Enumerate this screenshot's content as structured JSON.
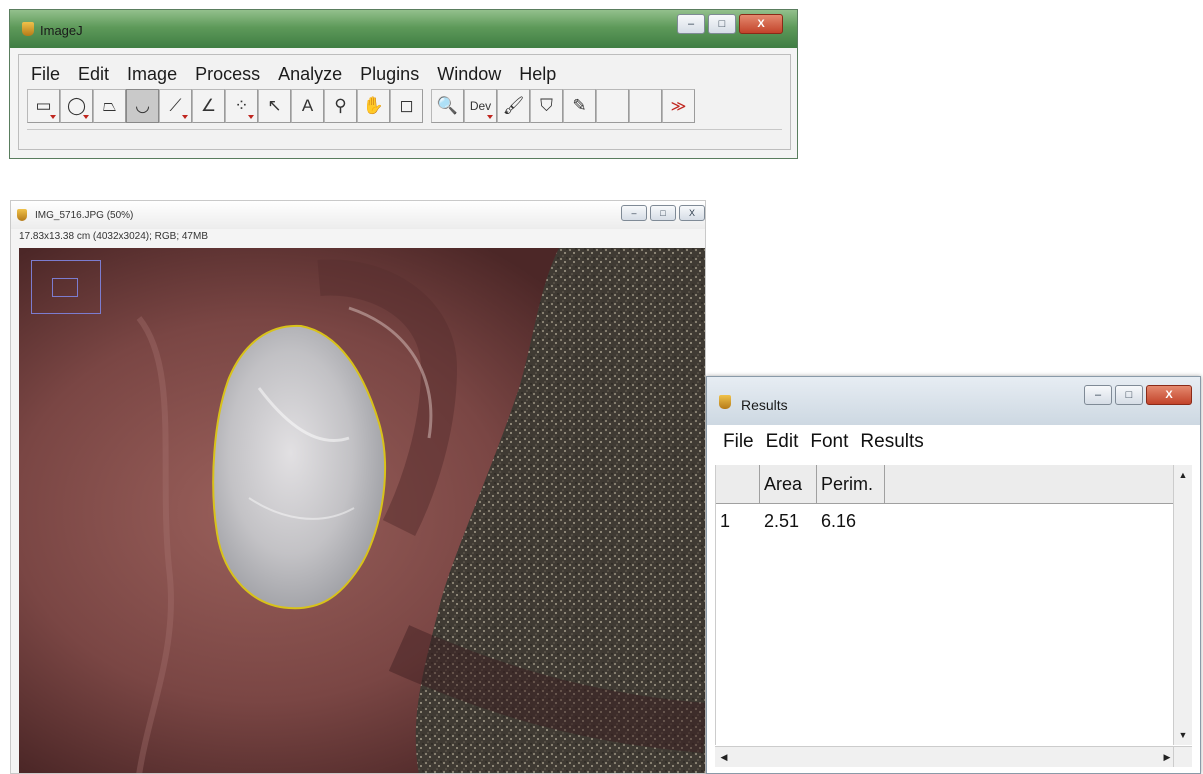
{
  "imagej": {
    "title": "ImageJ",
    "menu": [
      "File",
      "Edit",
      "Image",
      "Process",
      "Analyze",
      "Plugins",
      "Window",
      "Help"
    ],
    "tools": [
      {
        "name": "rectangle-tool-icon",
        "glyph": "▭",
        "dropdown": true
      },
      {
        "name": "oval-tool-icon",
        "glyph": "◯",
        "dropdown": true
      },
      {
        "name": "polygon-tool-icon",
        "glyph": "⏢",
        "dropdown": false
      },
      {
        "name": "freehand-tool-icon",
        "glyph": "◡",
        "dropdown": false,
        "active": true
      },
      {
        "name": "line-tool-icon",
        "glyph": "⟋",
        "dropdown": true
      },
      {
        "name": "angle-tool-icon",
        "glyph": "∠",
        "dropdown": false
      },
      {
        "name": "multipoint-tool-icon",
        "glyph": "⁘",
        "dropdown": true
      },
      {
        "name": "wand-tool-icon",
        "glyph": "↖",
        "dropdown": false
      },
      {
        "name": "text-tool-icon",
        "glyph": "A",
        "dropdown": false
      },
      {
        "name": "magnifier-tool-icon",
        "glyph": "⚲",
        "dropdown": false
      },
      {
        "name": "hand-tool-icon",
        "glyph": "✋",
        "dropdown": false
      },
      {
        "name": "color-picker-tool-icon",
        "glyph": "◻",
        "dropdown": false
      },
      {
        "name": "gap"
      },
      {
        "name": "zoom-tool-icon",
        "glyph": "🔍",
        "dropdown": false
      },
      {
        "name": "developer-menu-icon",
        "glyph": "Dev",
        "dropdown": true
      },
      {
        "name": "brush-tool-icon",
        "glyph": "🖌",
        "dropdown": false
      },
      {
        "name": "flood-fill-tool-icon",
        "glyph": "⛉",
        "dropdown": false
      },
      {
        "name": "pencil-tool-icon",
        "glyph": "✎",
        "dropdown": false
      },
      {
        "name": "empty-tool-slot",
        "glyph": "",
        "dropdown": false
      },
      {
        "name": "empty-tool-slot",
        "glyph": "",
        "dropdown": false
      },
      {
        "name": "more-tools-icon",
        "glyph": "≫",
        "dropdown": false
      }
    ],
    "window_buttons": {
      "minimize": "–",
      "maximize": "□",
      "close": "X"
    }
  },
  "image_window": {
    "title": "IMG_5716.JPG (50%)",
    "info": "17.83x13.38 cm (4032x3024); RGB; 47MB",
    "window_buttons": {
      "minimize": "–",
      "maximize": "□",
      "close": "X"
    }
  },
  "results": {
    "title": "Results",
    "menu": [
      "File",
      "Edit",
      "Font",
      "Results"
    ],
    "columns": [
      "",
      "Area",
      "Perim."
    ],
    "rows": [
      [
        "1",
        "2.51",
        "6.16"
      ]
    ],
    "window_buttons": {
      "minimize": "–",
      "maximize": "□",
      "close": "X"
    }
  },
  "colors": {
    "imagej_titlebar": "#5e9a5a",
    "roi_outline": "#d8c21a",
    "navigator_box": "#7c7ccf"
  }
}
